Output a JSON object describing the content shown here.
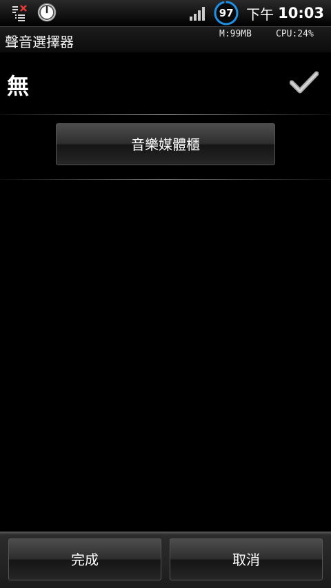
{
  "status_bar": {
    "battery_level": "97",
    "battery_fraction": 0.97,
    "time_ampm": "下午",
    "time_value": "10:03",
    "icons": [
      "task-manager-icon",
      "clock-icon",
      "signal-icon",
      "battery-ring-icon"
    ],
    "colors": {
      "battery_ring": "#1e90e6"
    }
  },
  "title_bar": {
    "title": "聲音選擇器",
    "memory": "M:99MB",
    "cpu": "CPU:24%"
  },
  "list": {
    "none_label": "無",
    "none_selected_icon": "check-icon",
    "media_button_label": "音樂媒體櫃"
  },
  "bottom_bar": {
    "done_label": "完成",
    "cancel_label": "取消"
  }
}
